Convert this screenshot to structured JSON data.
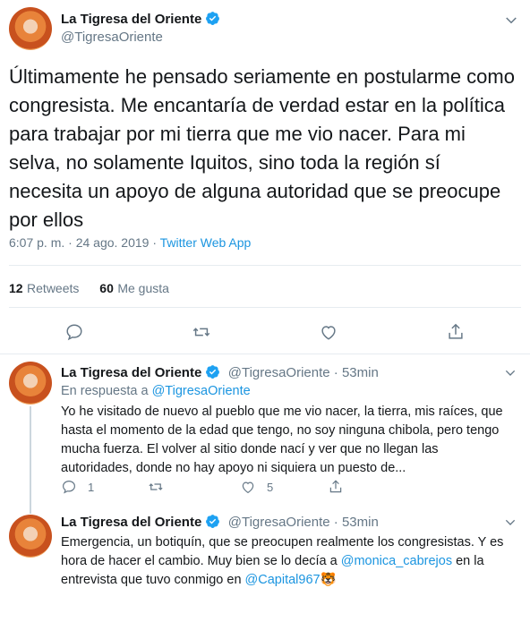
{
  "main_tweet": {
    "author_name": "La Tigresa del Oriente",
    "handle": "@TigresaOriente",
    "text": "Últimamente he pensado seriamente en postularme como congresista. Me encantaría de verdad estar en la política para trabajar por mi tierra que me vio nacer. Para mi selva, no solamente Iquitos, sino toda la región sí necesita un apoyo de alguna autoridad que se preocupe por ellos",
    "time": "6:07 p. m. · 24 ago. 2019 · ",
    "source": "Twitter Web App",
    "retweets_count": "12",
    "retweets_label": "Retweets",
    "likes_count": "60",
    "likes_label": "Me gusta"
  },
  "replies": [
    {
      "author_name": "La Tigresa del Oriente",
      "handle": "@TigresaOriente",
      "time": " · 53min",
      "reply_prefix": "En respuesta a ",
      "reply_to": "@TigresaOriente",
      "text": "Yo he visitado de nuevo al pueblo que me vio nacer, la tierra, mis raíces, que hasta el momento de la edad que tengo, no soy ninguna chibola, pero tengo mucha fuerza. El volver al sitio donde nací y ver que no llegan las autoridades, donde no hay apoyo ni siquiera un puesto de...",
      "reply_count": "1",
      "retweet_count": "",
      "like_count": "5"
    },
    {
      "author_name": "La Tigresa del Oriente",
      "handle": "@TigresaOriente",
      "time": " · 53min",
      "text_part1": "Emergencia, un botiquín, que se preocupen realmente los congresistas. Y es hora de hacer el cambio. Muy bien se lo decía a ",
      "mention1": "@monica_cabrejos",
      "text_part2": " en la entrevista que tuvo conmigo en ",
      "mention2": "@Capital967",
      "emoji": "🐯"
    }
  ],
  "icons": {
    "accent": "#1da1f2",
    "muted": "#657786"
  }
}
